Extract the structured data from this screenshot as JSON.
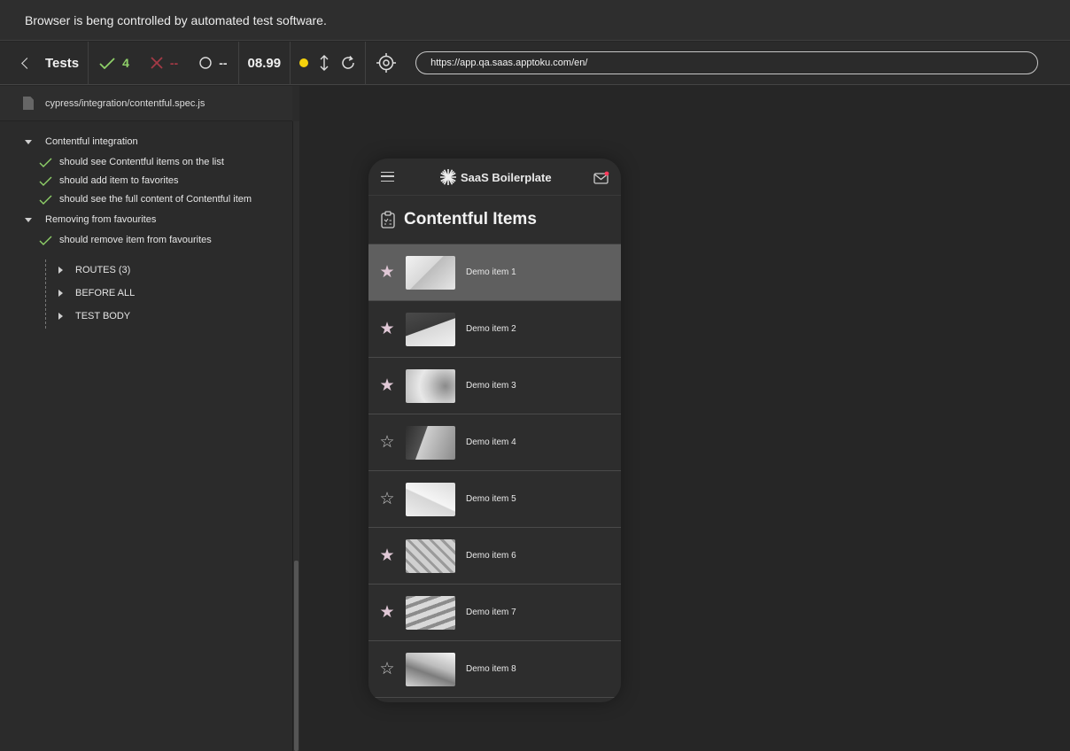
{
  "banner": {
    "text": "Browser is beng controlled by automated test software."
  },
  "toolbar": {
    "back_label": "Tests",
    "passed": "4",
    "failed": "--",
    "pending": "--",
    "duration": "08.99",
    "url": "https://app.qa.saas.apptoku.com/en/"
  },
  "sidebar": {
    "file": "cypress/integration/contentful.spec.js",
    "suites": [
      {
        "title": "Contentful integration",
        "tests": [
          "should see Contentful items on the list",
          "should add item to favorites",
          "should see the full content of Contentful item"
        ]
      },
      {
        "title": "Removing from favourites",
        "tests": [
          "should remove item from favourites"
        ]
      }
    ],
    "commands": [
      "ROUTES (3)",
      "BEFORE ALL",
      "TEST BODY"
    ]
  },
  "app": {
    "brand": "SaaS Boilerplate",
    "title": "Contentful Items",
    "items": [
      {
        "name": "Demo item 1",
        "favorite": true
      },
      {
        "name": "Demo item 2",
        "favorite": true
      },
      {
        "name": "Demo item 3",
        "favorite": true
      },
      {
        "name": "Demo item 4",
        "favorite": false
      },
      {
        "name": "Demo item 5",
        "favorite": false
      },
      {
        "name": "Demo item 6",
        "favorite": true
      },
      {
        "name": "Demo item 7",
        "favorite": true
      },
      {
        "name": "Demo item 8",
        "favorite": false
      }
    ]
  },
  "colors": {
    "pass": "#8fd069",
    "fail": "#a43a46",
    "running_dot": "#f5d20c",
    "star_filled": "#e0c8d6",
    "notification": "#ff3b5c"
  }
}
